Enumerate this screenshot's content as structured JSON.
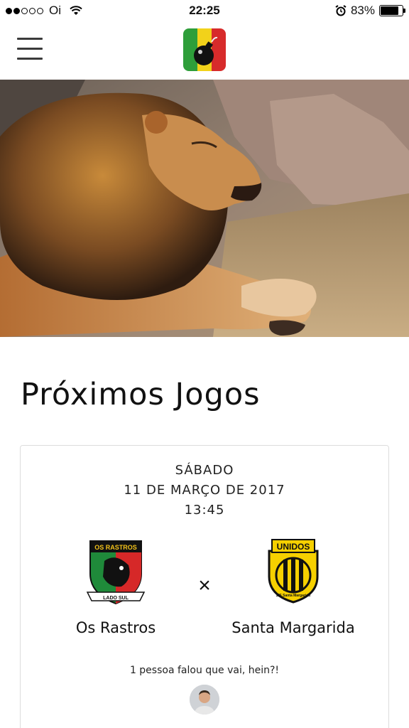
{
  "status_bar": {
    "carrier": "Oi",
    "time": "22:25",
    "battery": "83%",
    "battery_level": 0.83,
    "signal_bars": 2
  },
  "header": {
    "logo_colors": [
      "#2e9e3a",
      "#f2d21a",
      "#d72b2b"
    ]
  },
  "section": {
    "title": "Próximos Jogos"
  },
  "match": {
    "day": "SÁBADO",
    "date": "11 DE MARÇO DE 2017",
    "time": "13:45",
    "versus": "×",
    "home": {
      "name": "Os Rastros",
      "crest_text_top": "OS RASTROS",
      "crest_text_bottom": "LADO SUL",
      "crest_colors": [
        "#1f8a3a",
        "#f2c21a",
        "#d62828"
      ]
    },
    "away": {
      "name": "Santa Margarida",
      "crest_text_top": "UNIDOS",
      "crest_text_bottom": "Z/S Santa Margarida",
      "crest_colors": [
        "#111111",
        "#f6d000"
      ]
    },
    "attendance": "1 pessoa falou que vai, hein?!"
  }
}
